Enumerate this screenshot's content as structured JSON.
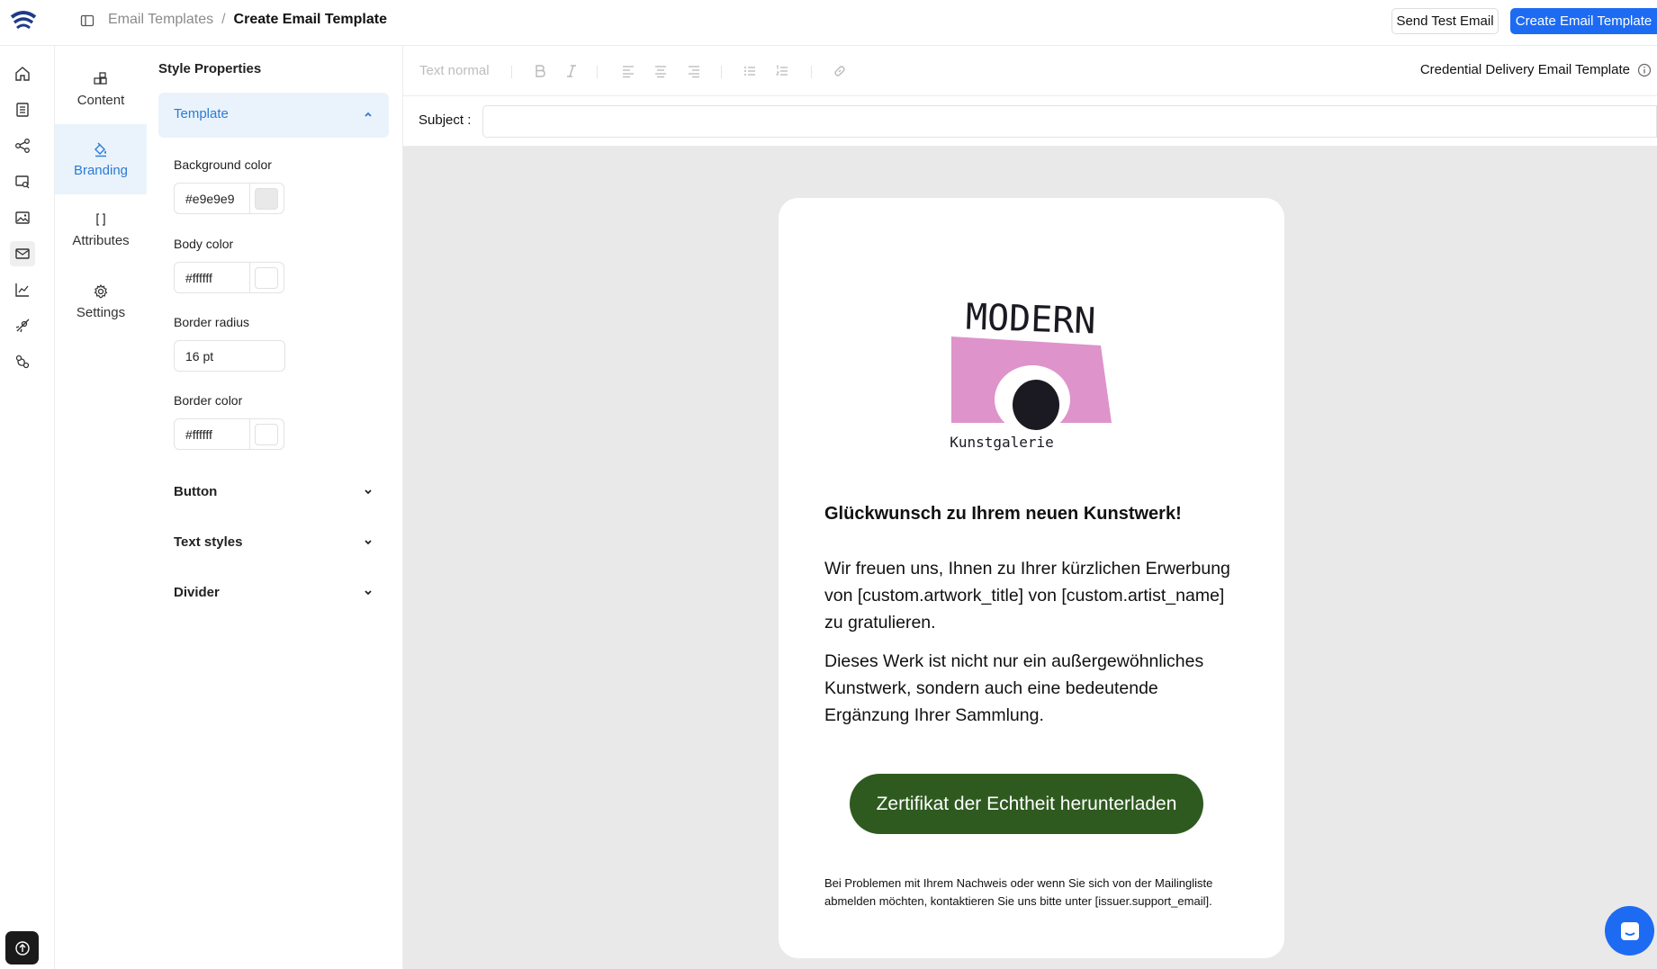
{
  "header": {
    "breadcrumb": [
      "Email Templates",
      "Create Email Template"
    ],
    "breadcrumb_separator": "/",
    "send_test_label": "Send Test Email",
    "create_label": "Create Email Template"
  },
  "rail": {
    "icons": [
      "home-icon",
      "list-icon",
      "flow-icon",
      "search-doc-icon",
      "image-icon",
      "mail-icon",
      "chart-icon",
      "rocket-icon",
      "hook-icon"
    ],
    "active": "mail-icon",
    "bottom_icon": "upload-icon"
  },
  "tabs": [
    {
      "label": "Content",
      "icon": "content-icon",
      "active": false
    },
    {
      "label": "Branding",
      "icon": "paint-bucket-icon",
      "active": true
    },
    {
      "label": "Attributes",
      "icon": "brackets-icon",
      "active": false
    },
    {
      "label": "Settings",
      "icon": "gear-icon",
      "active": false
    }
  ],
  "props": {
    "title": "Style Properties",
    "template_section": "Template",
    "background_color_label": "Background color",
    "background_color": "#e9e9e9",
    "background_color_display": "#e9e9e9",
    "body_color_label": "Body color",
    "body_color": "#ffffff",
    "body_color_display": "#ffffff",
    "border_radius_label": "Border radius",
    "border_radius_value": "16 pt",
    "border_color_label": "Border color",
    "border_color": "#ffffff",
    "border_color_display": "#ffffff",
    "sections": [
      "Button",
      "Text styles",
      "Divider"
    ]
  },
  "toolbar": {
    "text_style": "Text normal",
    "template_name": "Credential Delivery Email Template"
  },
  "subject": {
    "label": "Subject :",
    "value": ""
  },
  "email": {
    "logo_text_top": "MODERN",
    "logo_text_bottom": "Kunstgalerie",
    "logo_color": "#de93cb",
    "heading": "Glückwunsch zu Ihrem neuen Kunstwerk!",
    "paragraph1": "Wir freuen uns, Ihnen zu Ihrer kürzlichen Erwerbung von [custom.artwork_title] von [custom.artist_name] zu gratulieren.",
    "paragraph2": "Dieses Werk ist nicht nur ein außergewöhnliches Kunstwerk, sondern auch eine bedeutende Ergänzung Ihrer Sammlung.",
    "button_label": "Zertifikat der Echtheit herunterladen",
    "button_color": "#2e5a1f",
    "footer": "Bei Problemen mit Ihrem Nachweis oder wenn Sie sich von der Mailingliste abmelden möchten, kontaktieren Sie uns bitte unter [issuer.support_email]."
  },
  "colors": {
    "accent": "#1d6bf3",
    "active_tab_bg": "#eaf3fb",
    "active_tab_text": "#2c7ad6",
    "canvas_bg": "#e9e9e9"
  }
}
